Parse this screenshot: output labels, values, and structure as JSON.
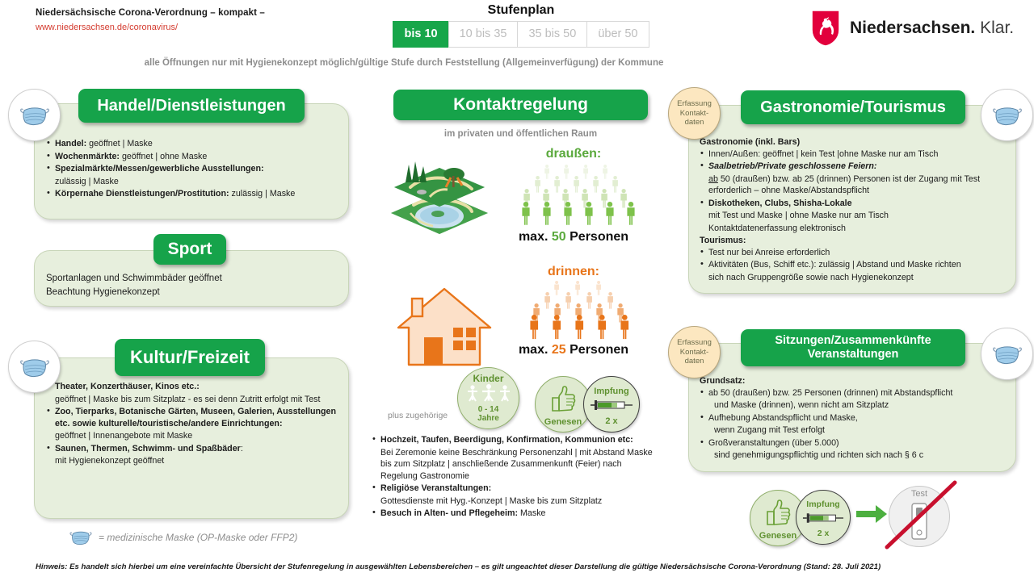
{
  "header": {
    "title": "Niedersächsische Corona-Verordnung – kompakt –",
    "url": "www.niedersachsen.de/coronavirus/",
    "stufenplan_label": "Stufenplan",
    "steps": [
      {
        "label": "bis 10",
        "active": true
      },
      {
        "label": "10 bis 35",
        "active": false
      },
      {
        "label": "35 bis 50",
        "active": false
      },
      {
        "label": "über 50",
        "active": false
      }
    ],
    "hygiene_note": "alle Öffnungen nur mit Hygienekonzept möglich/gültige Stufe durch Feststellung (Allgemeinverfügung) der Kommune",
    "logo_bold": "Niedersachsen.",
    "logo_light": "Klar."
  },
  "handel": {
    "title": "Handel/Dienstleistungen",
    "items": [
      {
        "bold": "Handel:",
        "rest": " geöffnet  |  Maske"
      },
      {
        "bold": "Wochenmärkte:",
        "rest": " geöffnet  |  ohne Maske"
      },
      {
        "bold": "Spezialmärkte/Messen/gewerbliche Ausstellungen:",
        "rest": ""
      },
      {
        "bold": "",
        "rest": "zulässig | Maske",
        "cont": true
      },
      {
        "bold": "Körpernahe Dienstleistungen/Prostitution:",
        "rest": "  zulässig | Maske"
      }
    ]
  },
  "sport": {
    "title": "Sport",
    "line1": "Sportanlagen und Schwimmbäder geöffnet",
    "line2": "Beachtung Hygienekonzept"
  },
  "kultur": {
    "title": "Kultur/Freizeit",
    "items": [
      {
        "bold": "Theater, Konzerthäuser, Kinos etc.:",
        "rest": ""
      },
      {
        "cont": true,
        "rest": "geöffnet  |  Maske bis zum Sitzplatz - es sei denn Zutritt erfolgt mit Test"
      },
      {
        "bold": "Zoo, Tierparks, Botanische Gärten, Museen, Galerien, Ausstellungen etc. sowie kulturelle/touristische/andere Einrichtungen:",
        "rest": ""
      },
      {
        "cont": true,
        "rest": "geöffnet  |  Innenangebote mit Maske"
      },
      {
        "bold": "Saunen, Thermen, Schwimm- und Spaßbäder",
        "rest": ":"
      },
      {
        "cont": true,
        "rest": "mit Hygienekonzept  geöffnet"
      }
    ]
  },
  "kontakt": {
    "title": "Kontaktregelung",
    "subtitle": "im privaten und öffentlichen Raum",
    "outdoor_label": "draußen:",
    "outdoor_max_prefix": "max. ",
    "outdoor_max_value": "50",
    "outdoor_max_suffix": " Personen",
    "indoor_label": "drinnen:",
    "indoor_max_prefix": "max. ",
    "indoor_max_value": "25",
    "indoor_max_suffix": " Personen",
    "plus_label": "plus zugehörige",
    "kinder_label": "Kinder",
    "kinder_age": "0 - 14",
    "kinder_age2": "Jahre",
    "genesen_label": "Genesen",
    "impfung_label": "Impfung",
    "impfung_count": "2 x",
    "events": [
      {
        "bold": "Hochzeit, Taufen, Beerdigung, Konfirmation, Kommunion etc:",
        "rest": ""
      },
      {
        "cont": true,
        "rest": "Bei Zeremonie keine Beschränkung Personenzahl | mit Abstand  Maske bis zum Sitzplatz |  anschließende Zusammenkunft (Feier) nach Regelung Gastronomie"
      },
      {
        "bold": "Religiöse Veranstaltungen:",
        "rest": ""
      },
      {
        "cont": true,
        "rest": "Gottesdienste mit Hyg.-Konzept   |  Maske bis zum Sitzplatz"
      },
      {
        "bold": "Besuch in Alten- und Pflegeheim:",
        "rest": " Maske"
      }
    ]
  },
  "gastro": {
    "title": "Gastronomie/Tourismus",
    "contact_badge": [
      "Erfassung",
      "Kontakt-",
      "daten"
    ],
    "heading1": "Gastronomie (inkl. Bars)",
    "items1": [
      {
        "bold": "",
        "rest": "Innen/Außen:  geöffnet  |  kein Test |ohne Maske nur am Tisch"
      },
      {
        "italicbold": "Saalbetrieb/Private geschlossene Feiern:",
        "rest": ""
      },
      {
        "cont": true,
        "underline": "ab",
        "rest": " 50 (draußen) bzw. ab 25 (drinnen) Personen ist der Zugang mit Test erforderlich – ohne Maske/Abstandspflicht"
      },
      {
        "bold": "Diskotheken, Clubs, Shisha-Lokale",
        "rest": ""
      },
      {
        "cont": true,
        "rest": "mit Test und Maske |  ohne Maske nur am Tisch"
      },
      {
        "cont": true,
        "rest": "Kontaktdatenerfassung elektronisch"
      }
    ],
    "heading2": "Tourismus:",
    "items2": [
      {
        "rest": "Test nur bei Anreise erforderlich"
      },
      {
        "rest": "Aktivitäten (Bus, Schiff etc.):  zulässig | Abstand und Maske richten"
      },
      {
        "cont": true,
        "rest": "sich nach Gruppengröße sowie nach Hygienekonzept"
      }
    ]
  },
  "sitzungen": {
    "title_line1": "Sitzungen/Zusammenkünfte",
    "title_line2": "Veranstaltungen",
    "contact_badge": [
      "Erfassung",
      "Kontakt-",
      "daten"
    ],
    "heading": "Grundsatz:",
    "items": [
      {
        "rest": "ab 50 (draußen) bzw. 25 Personen (drinnen) mit Abstandspflicht"
      },
      {
        "cont": true,
        "rest": "und Maske (drinnen), wenn nicht am Sitzplatz"
      },
      {
        "rest": "Aufhebung  Abstandspflicht und Maske,"
      },
      {
        "cont": true,
        "rest": "wenn Zugang mit Test erfolgt"
      },
      {
        "rest": "Großveranstaltungen (über 5.000)"
      },
      {
        "cont": true,
        "rest": "sind genehmigungspflichtig und richten sich nach § 6 c"
      }
    ],
    "diagram": {
      "genesen_label": "Genesen",
      "impfung_label": "Impfung",
      "impfung_count": "2 x",
      "test_label": "Test"
    }
  },
  "footer": {
    "mask_legend": "= medizinische Maske (OP-Maske oder FFP2)",
    "note": "Hinweis: Es handelt sich hierbei um eine vereinfachte Übersicht der Stufenregelung in ausgewählten Lebensbereichen – es gilt ungeachtet dieser Darstellung die gültige Niedersächsische Corona-Verordnung (Stand: 28. Juli 2021)"
  },
  "colors": {
    "green": "#16a34a",
    "panel_bg": "#e7efdd",
    "orange": "#e8751a",
    "red": "#d43b2f",
    "badge_beige": "#fce7c0"
  }
}
